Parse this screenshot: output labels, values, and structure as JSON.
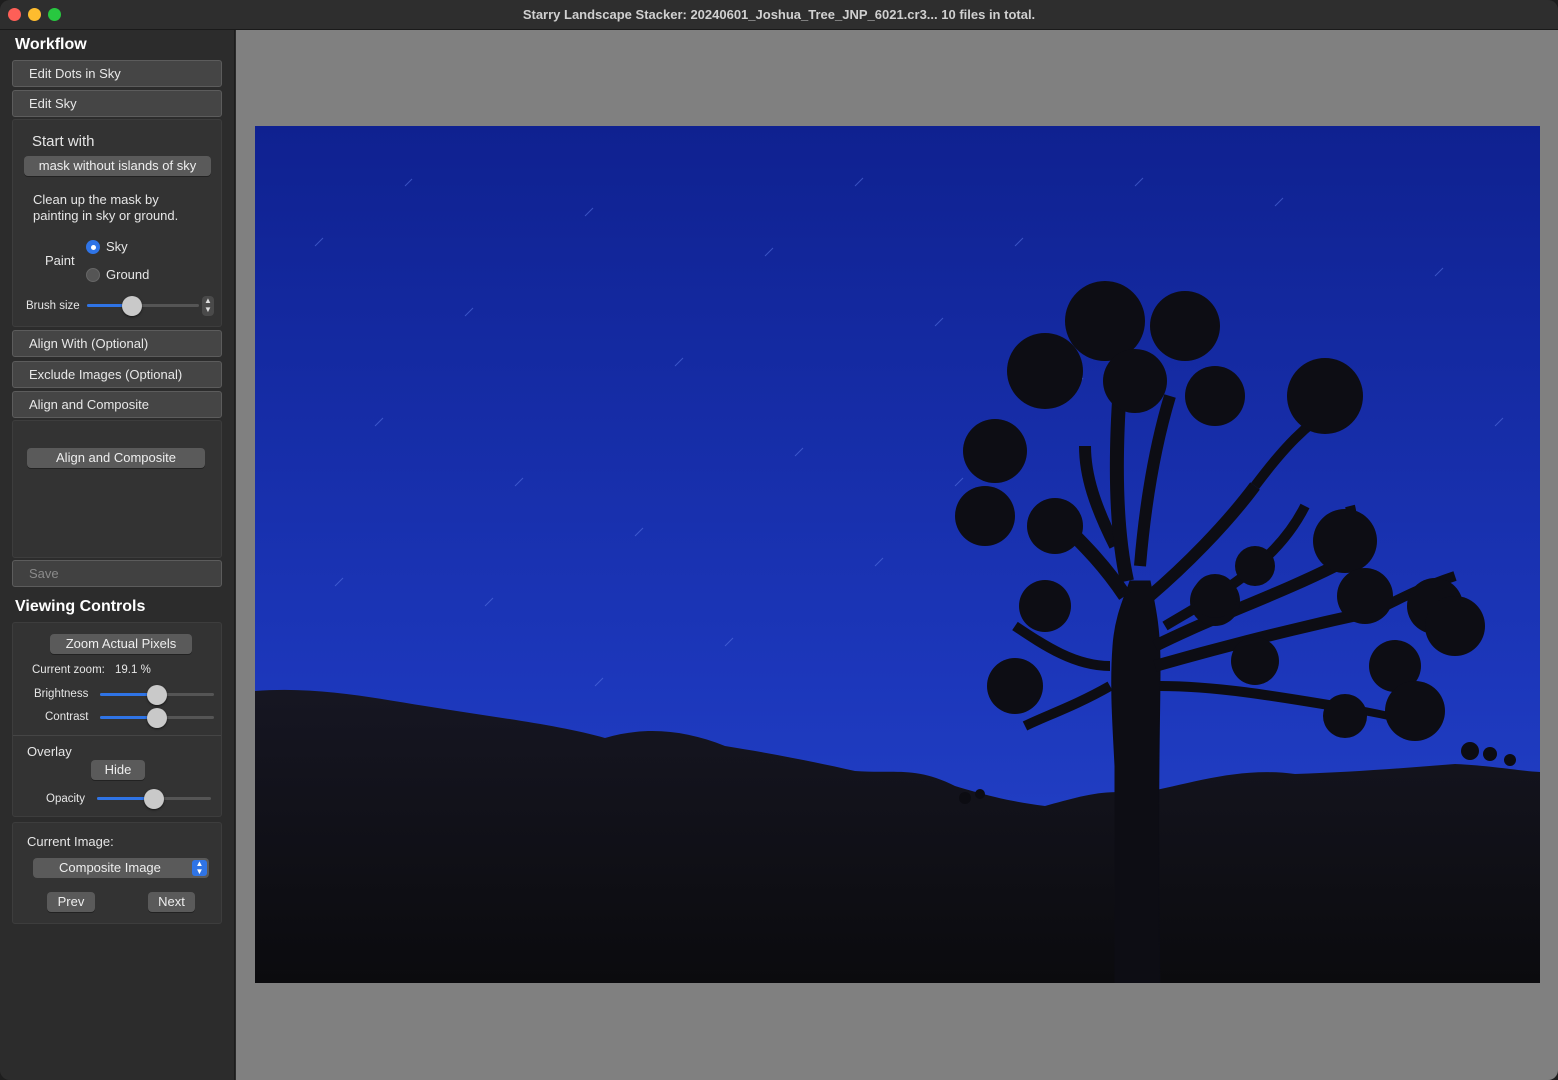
{
  "window": {
    "title": "Starry Landscape Stacker: 20240601_Joshua_Tree_JNP_6021.cr3...  10 files in total."
  },
  "workflow": {
    "heading": "Workflow",
    "edit_dots": "Edit Dots in Sky",
    "edit_sky": "Edit Sky",
    "start_with_label": "Start with",
    "start_with_button": "mask without islands of sky",
    "instructions_line1": "Clean up the mask by",
    "instructions_line2": "painting in sky or ground.",
    "paint_label": "Paint",
    "paint_options": [
      "Sky",
      "Ground"
    ],
    "paint_selected": "Sky",
    "brush_size_label": "Brush size",
    "brush_size_fraction": 0.4,
    "align_with": "Align With (Optional)",
    "exclude_images": "Exclude Images (Optional)",
    "align_composite_step": "Align and Composite",
    "align_composite_button": "Align and Composite",
    "save": "Save"
  },
  "viewing": {
    "heading": "Viewing Controls",
    "zoom_button": "Zoom Actual Pixels",
    "current_zoom_label": "Current zoom:",
    "current_zoom_value": "19.1 %",
    "brightness_label": "Brightness",
    "brightness_fraction": 0.5,
    "contrast_label": "Contrast",
    "contrast_fraction": 0.5,
    "overlay_label": "Overlay",
    "hide_button": "Hide",
    "opacity_label": "Opacity",
    "opacity_fraction": 0.5
  },
  "current_image": {
    "label": "Current Image:",
    "selected": "Composite Image",
    "prev": "Prev",
    "next": "Next"
  },
  "colors": {
    "accent": "#2f74e6",
    "sky_top": "#0e1f86",
    "sky_bottom": "#2240c8"
  }
}
